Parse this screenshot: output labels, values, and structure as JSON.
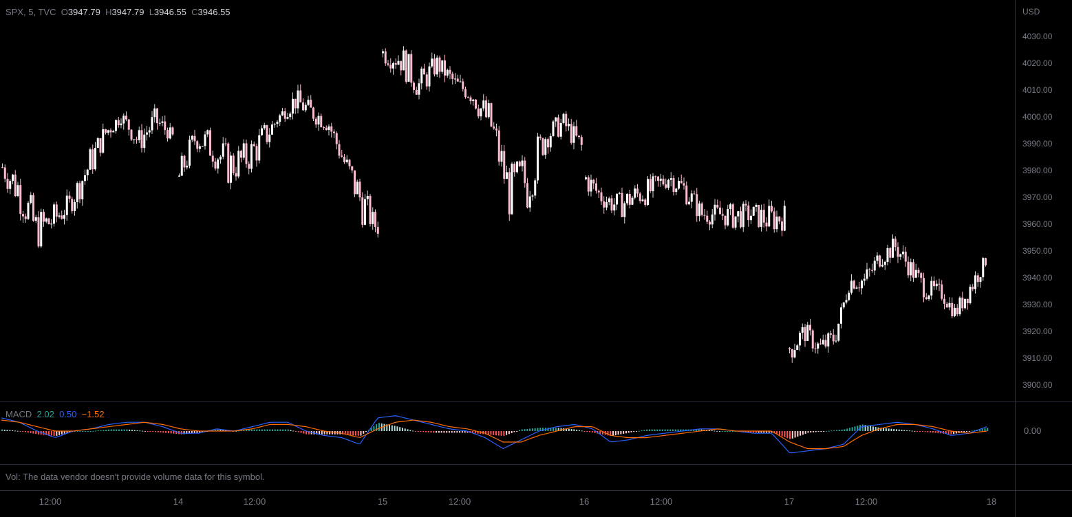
{
  "header": {
    "symbol": "SPX, 5, TVC",
    "o_label": "O",
    "o": "3947.79",
    "h_label": "H",
    "h": "3947.79",
    "l_label": "L",
    "l": "3946.55",
    "c_label": "C",
    "c": "3946.55"
  },
  "price_axis": {
    "currency": "USD",
    "ticks": [
      "4030.00",
      "4020.00",
      "4010.00",
      "4000.00",
      "3990.00",
      "3980.00",
      "3970.00",
      "3960.00",
      "3950.00",
      "3940.00",
      "3930.00",
      "3920.00",
      "3910.00",
      "3900.00"
    ]
  },
  "macd": {
    "label": "MACD",
    "hist": "2.02",
    "macd": "0.50",
    "signal": "−1.52",
    "axis_tick": "0.00",
    "colors": {
      "hist_label": "#26a69a",
      "macd_label": "#2962ff",
      "signal_label": "#ff6d00",
      "hist_up_strong": "#26a69a",
      "hist_up_weak": "#b2dfdb",
      "hist_down_strong": "#ff5252",
      "hist_down_weak": "#ffcdd2",
      "macd_line": "#2962ff",
      "signal_line": "#ff6d00"
    }
  },
  "volume": {
    "message": "Vol: The data vendor doesn't provide volume data for this symbol."
  },
  "time_axis": {
    "labels": [
      "12:00",
      "14",
      "12:00",
      "15",
      "12:00",
      "16",
      "12:00",
      "17",
      "12:00",
      "18"
    ]
  },
  "chart_data": {
    "type": "candlestick",
    "ylim": [
      3895,
      4037
    ],
    "candle_colors": {
      "up": "#ffffff",
      "down": "#f8bbd0",
      "wick": "#d1d4dc"
    },
    "sessions": [
      {
        "label_start": "13",
        "segments": [
          [
            3978,
            3985
          ],
          [
            3966,
            3980
          ],
          [
            3952,
            3964
          ],
          [
            3958,
            3966
          ],
          [
            3966,
            3970
          ],
          [
            3976,
            3986
          ],
          [
            3992,
            3996
          ],
          [
            4000,
            4001
          ],
          [
            3988,
            3994
          ],
          [
            3996,
            4002
          ],
          [
            3993,
            3993
          ]
        ]
      },
      {
        "label_start": "14",
        "segments": [
          [
            3974,
            3982
          ],
          [
            3990,
            3996
          ],
          [
            3984,
            3994
          ],
          [
            3976,
            3988
          ],
          [
            3980,
            3989
          ],
          [
            3986,
            3996
          ],
          [
            4000,
            4000
          ],
          [
            4004,
            4009
          ],
          [
            4000,
            4004
          ],
          [
            3996,
            4000
          ],
          [
            3980,
            3986
          ],
          [
            3962,
            3976
          ],
          [
            3958,
            3958
          ]
        ]
      },
      {
        "label_start": "15",
        "segments": [
          [
            4022,
            4026
          ],
          [
            4018,
            4026
          ],
          [
            4008,
            4016
          ],
          [
            4018,
            4022
          ],
          [
            4012,
            4014
          ],
          [
            4006,
            4010
          ],
          [
            3990,
            4004
          ],
          [
            3964,
            3980
          ],
          [
            3966,
            3988
          ],
          [
            3990,
            3996
          ],
          [
            3996,
            4000
          ],
          [
            3986,
            3992
          ]
        ]
      },
      {
        "label_start": "16",
        "segments": [
          [
            3974,
            3980
          ],
          [
            3968,
            3972
          ],
          [
            3964,
            3970
          ],
          [
            3968,
            3974
          ],
          [
            3970,
            3976
          ],
          [
            3976,
            3980
          ],
          [
            3970,
            3976
          ],
          [
            3962,
            3966
          ],
          [
            3962,
            3966
          ],
          [
            3960,
            3966
          ],
          [
            3962,
            3966
          ],
          [
            3958,
            3966
          ],
          [
            3960,
            3966
          ]
        ]
      },
      {
        "label_start": "17",
        "segments": [
          [
            3910,
            3918
          ],
          [
            3918,
            3922
          ],
          [
            3912,
            3916
          ],
          [
            3916,
            3920
          ],
          [
            3938,
            3940
          ],
          [
            3936,
            3942
          ],
          [
            3946,
            3950
          ],
          [
            3950,
            3954
          ],
          [
            3942,
            3946
          ],
          [
            3934,
            3938
          ],
          [
            3934,
            3936
          ],
          [
            3926,
            3928
          ],
          [
            3934,
            3940
          ],
          [
            3946,
            3947
          ]
        ]
      }
    ],
    "macd_series": {
      "hist_range": [
        -3,
        3
      ],
      "line_range": [
        -14,
        8
      ],
      "macd_keypoints": [
        6,
        4,
        0,
        -3,
        0,
        1,
        3,
        4,
        4,
        2,
        -1,
        -1,
        1,
        0,
        2,
        4,
        4,
        0,
        -2,
        -3,
        -6,
        6,
        7,
        5,
        3,
        1,
        0,
        -3,
        -8,
        -4,
        0,
        2,
        3,
        1,
        -5,
        -4,
        -2,
        -1,
        0,
        1,
        1,
        0,
        -1,
        -1,
        -10,
        -9,
        -8,
        -6,
        2,
        3,
        4,
        3,
        1,
        -2,
        -1,
        2
      ],
      "signal_keypoints": [
        5,
        4,
        2,
        0,
        0,
        1,
        2,
        3,
        4,
        3,
        1,
        0,
        0,
        0,
        1,
        3,
        3,
        2,
        0,
        -1,
        -3,
        1,
        4,
        5,
        4,
        2,
        1,
        -1,
        -5,
        -5,
        -2,
        0,
        2,
        2,
        -2,
        -3,
        -3,
        -2,
        -1,
        0,
        1,
        0,
        0,
        0,
        -5,
        -8,
        -8,
        -7,
        -2,
        1,
        3,
        3,
        2,
        0,
        -1,
        0
      ]
    }
  }
}
